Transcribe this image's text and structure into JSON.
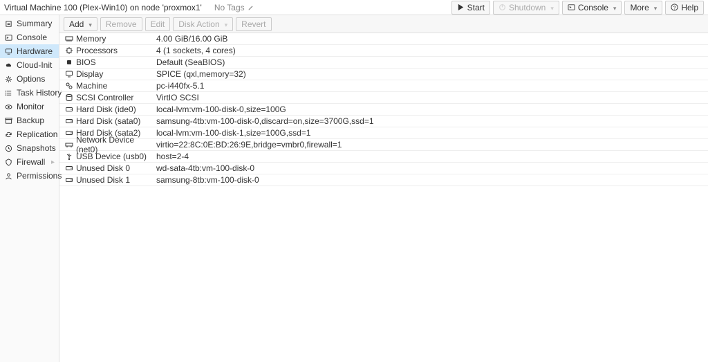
{
  "header": {
    "title": "Virtual Machine 100 (Plex-Win10) on node 'proxmox1'",
    "tags_label": "No Tags",
    "buttons": {
      "start": "Start",
      "shutdown": "Shutdown",
      "console": "Console",
      "more": "More",
      "help": "Help"
    }
  },
  "sidebar": {
    "items": [
      {
        "id": "summary",
        "label": "Summary",
        "icon": "note"
      },
      {
        "id": "console",
        "label": "Console",
        "icon": "terminal"
      },
      {
        "id": "hardware",
        "label": "Hardware",
        "icon": "monitor",
        "selected": true
      },
      {
        "id": "cloud-init",
        "label": "Cloud-Init",
        "icon": "cloud"
      },
      {
        "id": "options",
        "label": "Options",
        "icon": "gear"
      },
      {
        "id": "task-history",
        "label": "Task History",
        "icon": "list"
      },
      {
        "id": "monitor",
        "label": "Monitor",
        "icon": "eye"
      },
      {
        "id": "backup",
        "label": "Backup",
        "icon": "archive"
      },
      {
        "id": "replication",
        "label": "Replication",
        "icon": "sync"
      },
      {
        "id": "snapshots",
        "label": "Snapshots",
        "icon": "history"
      },
      {
        "id": "firewall",
        "label": "Firewall",
        "icon": "shield",
        "expandable": true
      },
      {
        "id": "permissions",
        "label": "Permissions",
        "icon": "user"
      }
    ]
  },
  "toolbar": {
    "add": "Add",
    "remove": "Remove",
    "edit": "Edit",
    "disk_action": "Disk Action",
    "revert": "Revert"
  },
  "hardware": [
    {
      "icon": "memory",
      "label": "Memory",
      "value": "4.00 GiB/16.00 GiB"
    },
    {
      "icon": "cpu",
      "label": "Processors",
      "value": "4 (1 sockets, 4 cores)"
    },
    {
      "icon": "chip",
      "label": "BIOS",
      "value": "Default (SeaBIOS)"
    },
    {
      "icon": "monitor",
      "label": "Display",
      "value": "SPICE (qxl,memory=32)"
    },
    {
      "icon": "gears",
      "label": "Machine",
      "value": "pc-i440fx-5.1"
    },
    {
      "icon": "disk",
      "label": "SCSI Controller",
      "value": "VirtIO SCSI"
    },
    {
      "icon": "hdd",
      "label": "Hard Disk (ide0)",
      "value": "local-lvm:vm-100-disk-0,size=100G"
    },
    {
      "icon": "hdd",
      "label": "Hard Disk (sata0)",
      "value": "samsung-4tb:vm-100-disk-0,discard=on,size=3700G,ssd=1"
    },
    {
      "icon": "hdd",
      "label": "Hard Disk (sata2)",
      "value": "local-lvm:vm-100-disk-1,size=100G,ssd=1"
    },
    {
      "icon": "net",
      "label": "Network Device (net0)",
      "value": "virtio=22:8C:0E:BD:26:9E,bridge=vmbr0,firewall=1"
    },
    {
      "icon": "usb",
      "label": "USB Device (usb0)",
      "value": "host=2-4"
    },
    {
      "icon": "hdd",
      "label": "Unused Disk 0",
      "value": "wd-sata-4tb:vm-100-disk-0"
    },
    {
      "icon": "hdd",
      "label": "Unused Disk 1",
      "value": "samsung-8tb:vm-100-disk-0"
    }
  ]
}
